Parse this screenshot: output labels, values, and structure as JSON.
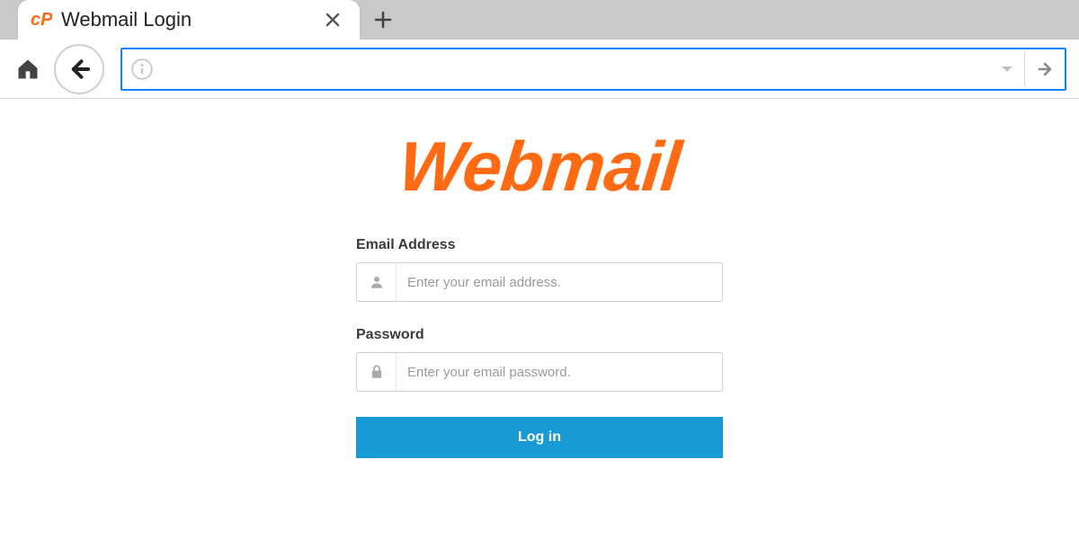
{
  "browser": {
    "tab_title": "Webmail Login",
    "url": ""
  },
  "page": {
    "logo_text": "Webmail",
    "logo_color": "#ff6a13",
    "email_label": "Email Address",
    "email_placeholder": "Enter your email address.",
    "password_label": "Password",
    "password_placeholder": "Enter your email password.",
    "login_button_label": "Log in",
    "accent_color": "#179bd7"
  }
}
